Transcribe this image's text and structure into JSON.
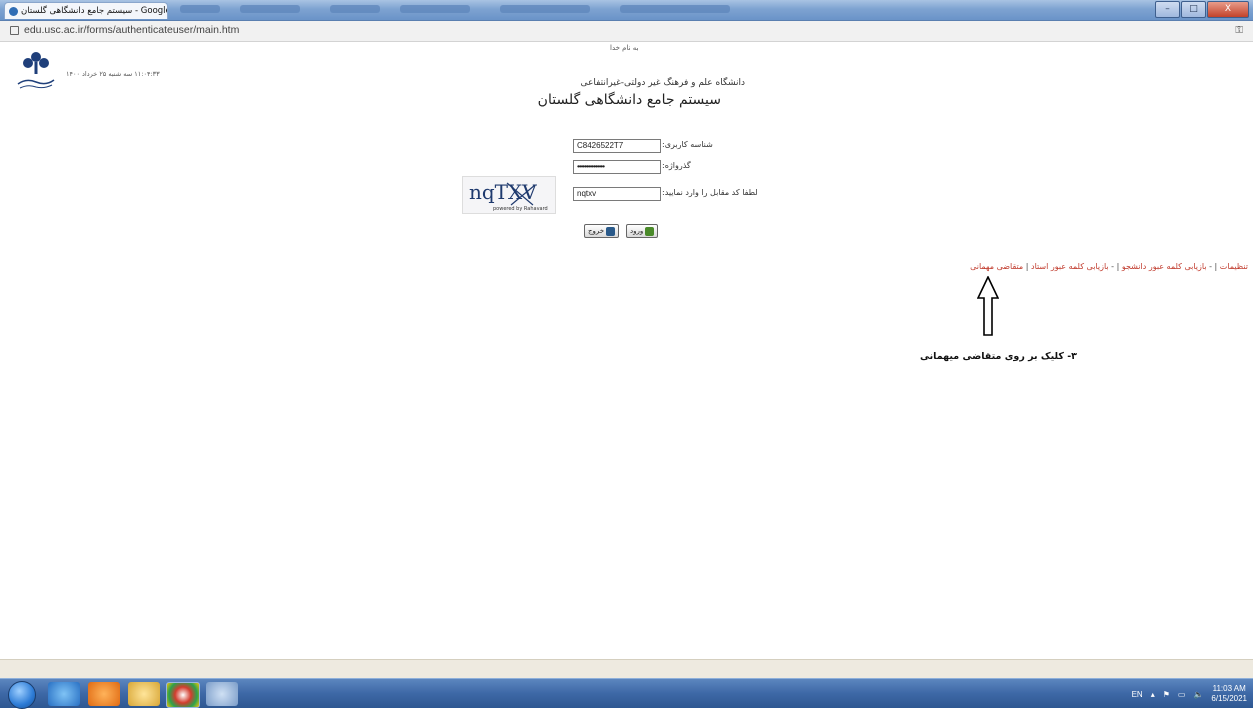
{
  "window": {
    "tab_title": "سیستم جامع دانشگاهی گلستان - Google Chrome",
    "min_label": "–",
    "max_label": "□",
    "close_label": "X"
  },
  "address": {
    "url": "edu.usc.ac.ir/forms/authenticateuser/main.htm"
  },
  "page": {
    "bismillah": "به نام خدا",
    "datetime": "۱۱:۰۴:۳۳ سه شنبه ۲۵ خرداد ۱۴۰۰",
    "university_subtitle": "دانشگاه علم و فرهنگ غیر دولتی-غیرانتفاعی",
    "system_title": "سیستم جامع دانشگاهی گلستان"
  },
  "form": {
    "username_label": "شناسه کاربری:",
    "username_value": "C8426522T7",
    "password_label": "گذرواژه:",
    "password_value": "•••••••••••••••",
    "captcha_label": "لطفا کد مقابل را وارد نمایید:",
    "captcha_value": "nqtxv",
    "captcha_image_text": "nqTXV",
    "captcha_powered": "powered by Rahavard",
    "login_button": "ورود",
    "exit_button": "خروج"
  },
  "links": [
    {
      "label": "تنظیمات"
    },
    {
      "label": "بازیابی کلمه عبور دانشجو"
    },
    {
      "label": "بازیابی کلمه عبور استاد"
    },
    {
      "label": "متقاضی مهمانی"
    }
  ],
  "annotation": {
    "instruction": "۳- کلیک بر روی متقاضی میهمانی"
  },
  "taskbar": {
    "language": "EN",
    "time": "11:03 AM",
    "date": "6/15/2021"
  },
  "colors": {
    "link_red": "#c0392b",
    "taskbar_blue": "#3d68a6"
  }
}
